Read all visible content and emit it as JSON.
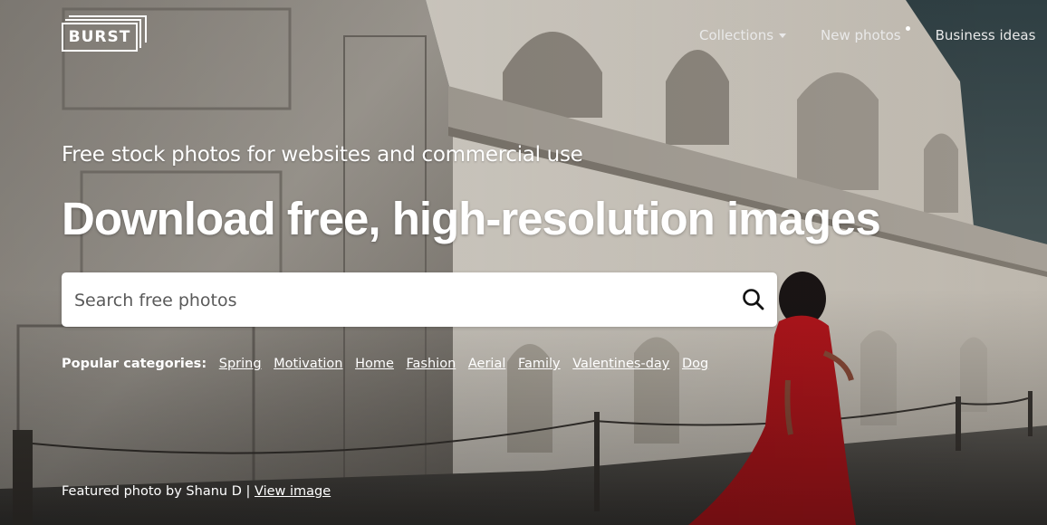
{
  "brand": {
    "logo_text": "BURST"
  },
  "nav": {
    "collections": "Collections",
    "new_photos": "New photos",
    "business_ideas": "Business ideas"
  },
  "hero": {
    "subtitle": "Free stock photos for websites and commercial use",
    "headline": "Download free, high-resolution images"
  },
  "search": {
    "placeholder": "Search free photos",
    "value": ""
  },
  "categories": {
    "label": "Popular categories:",
    "items": [
      "Spring",
      "Motivation",
      "Home",
      "Fashion",
      "Aerial",
      "Family",
      "Valentines-day",
      "Dog"
    ]
  },
  "credit": {
    "text": "Featured photo by Shanu D |",
    "link": "View image"
  },
  "colors": {
    "text": "#ffffff",
    "search_bg": "#ffffff",
    "dress": "#b3161c"
  }
}
